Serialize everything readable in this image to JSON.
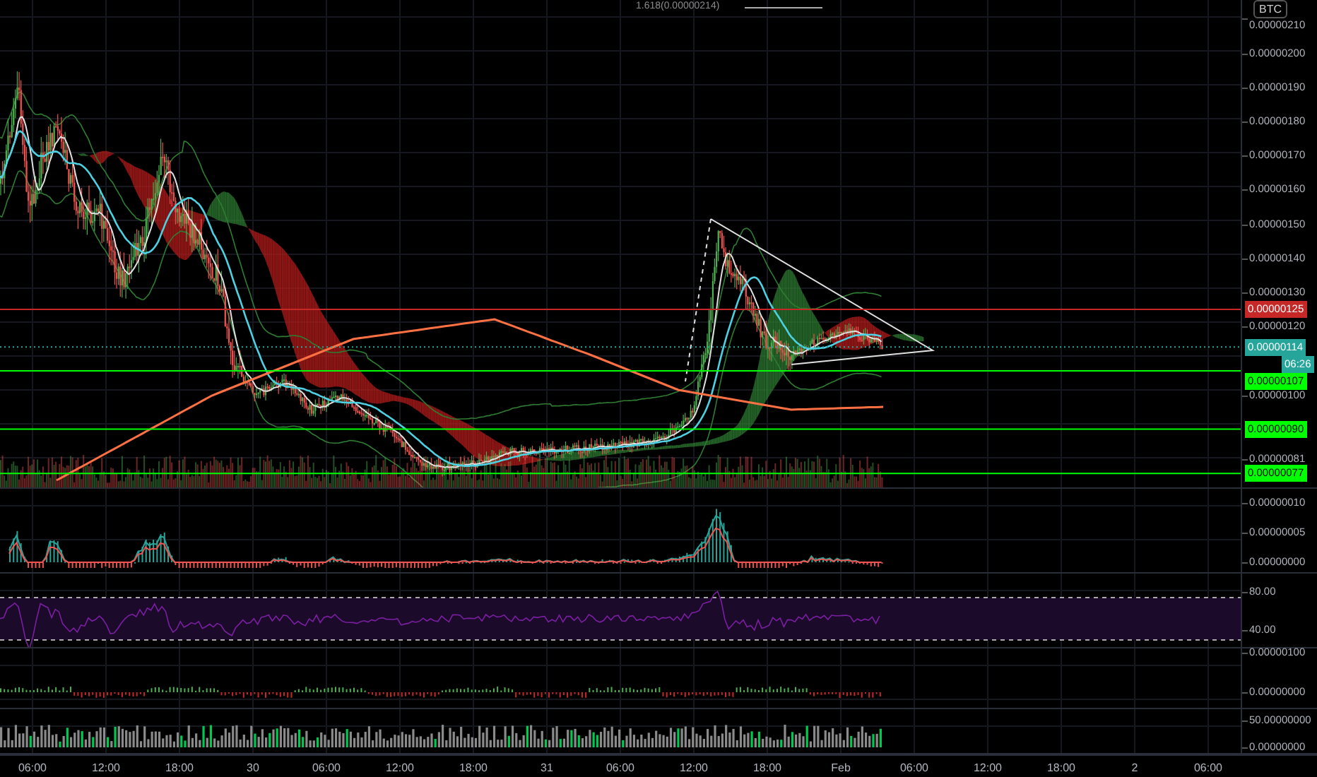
{
  "fib_level": {
    "label": "1.618(0.00000214)"
  },
  "currency_badge": "BTC",
  "price_pane": {
    "axis_labels": [
      "0.00000210",
      "0.00000200",
      "0.00000190",
      "0.00000180",
      "0.00000170",
      "0.00000160",
      "0.00000150",
      "0.00000140",
      "0.00000130",
      "0.00000120",
      "0.00000100",
      "0.00000081"
    ],
    "price_tags": [
      {
        "kind": "level",
        "text": "0.00000125",
        "color": "#c62828"
      },
      {
        "kind": "last",
        "text": "0.00000114",
        "color": "#26a69a"
      },
      {
        "kind": "countdown",
        "text": "06:26",
        "color": "#26a69a"
      },
      {
        "kind": "level",
        "text": "0.00000107",
        "color": "#00ff00"
      },
      {
        "kind": "level",
        "text": "0.00000090",
        "color": "#00ff00"
      },
      {
        "kind": "level",
        "text": "0.00000077",
        "color": "#00ff00"
      }
    ]
  },
  "macd_pane": {
    "axis_labels": [
      "0.00000010",
      "0.00000005",
      "0.00000000"
    ]
  },
  "rsi_pane": {
    "axis_labels": [
      "80.00",
      "40.00"
    ]
  },
  "pane_4": {
    "axis_labels": [
      "0.00000100",
      "0.00000000"
    ]
  },
  "volume_pane": {
    "axis_labels": [
      "50.00000000",
      "0.00000000"
    ]
  },
  "time_axis": {
    "labels": [
      "06:00",
      "12:00",
      "18:00",
      "30",
      "06:00",
      "12:00",
      "18:00",
      "31",
      "06:00",
      "12:00",
      "18:00",
      "Feb",
      "06:00",
      "12:00",
      "18:00",
      "2",
      "06:00"
    ]
  }
}
